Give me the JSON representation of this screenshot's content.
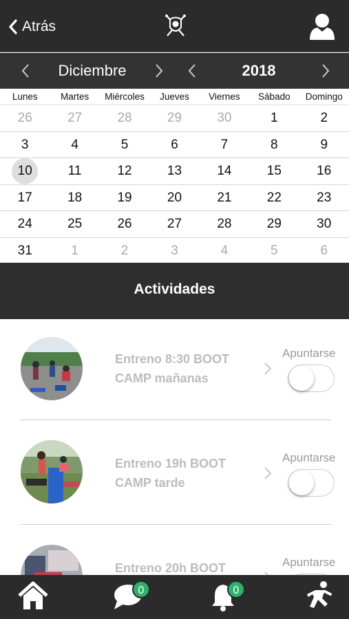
{
  "header": {
    "back_label": "Atrás"
  },
  "calendar": {
    "month": "Diciembre",
    "year": "2018",
    "weekdays": [
      "Lunes",
      "Martes",
      "Miércoles",
      "Jueves",
      "Viernes",
      "Sábado",
      "Domingo"
    ],
    "weeks": [
      [
        "26",
        "27",
        "28",
        "29",
        "30",
        "1",
        "2"
      ],
      [
        "3",
        "4",
        "5",
        "6",
        "7",
        "8",
        "9"
      ],
      [
        "10",
        "11",
        "12",
        "13",
        "14",
        "15",
        "16"
      ],
      [
        "17",
        "18",
        "19",
        "20",
        "21",
        "22",
        "23"
      ],
      [
        "24",
        "25",
        "26",
        "27",
        "28",
        "29",
        "30"
      ],
      [
        "31",
        "1",
        "2",
        "3",
        "4",
        "5",
        "6"
      ]
    ],
    "today": "10"
  },
  "activities": {
    "title": "Actividades",
    "items": [
      {
        "line1": "Entreno 8:30 BOOT",
        "line2": "CAMP mañanas",
        "signup_label": "Apuntarse"
      },
      {
        "line1": "Entreno 19h BOOT",
        "line2": "CAMP tarde",
        "signup_label": "Apuntarse"
      },
      {
        "line1": "Entreno 20h BOOT",
        "line2": "",
        "signup_label": "Apuntarse"
      }
    ]
  },
  "bottom_nav": {
    "messages_count": "0",
    "notifications_count": "0"
  }
}
